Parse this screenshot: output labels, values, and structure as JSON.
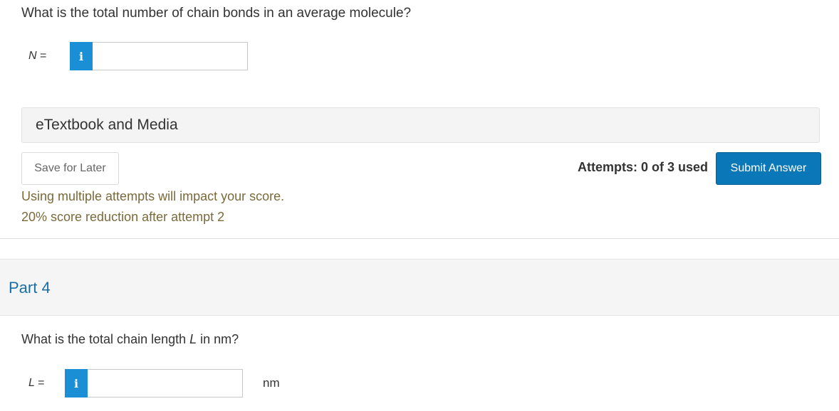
{
  "part3": {
    "question": "What is the total number of chain bonds in an average molecule?",
    "answer_var": "N",
    "answer_eq": "=",
    "info_icon": "i",
    "input_value": ""
  },
  "etextbook_label": "eTextbook and Media",
  "save_label": "Save for Later",
  "attempts_text": "Attempts: 0 of 3 used",
  "submit_label": "Submit Answer",
  "warning_line1": "Using multiple attempts will impact your score.",
  "warning_line2": "20% score reduction after attempt 2",
  "part4": {
    "title": "Part 4",
    "question_pre": "What is the total chain length ",
    "question_var": "L",
    "question_post": " in nm?",
    "answer_var": "L",
    "answer_eq": "=",
    "info_icon": "i",
    "input_value": "",
    "unit": "nm"
  },
  "colors": {
    "info_button": "#1a8fd6",
    "submit_button": "#0a77b8",
    "part_title": "#1a6fa8",
    "warning_text": "#7a6a3a"
  },
  "icons": {
    "info": "info-icon"
  }
}
